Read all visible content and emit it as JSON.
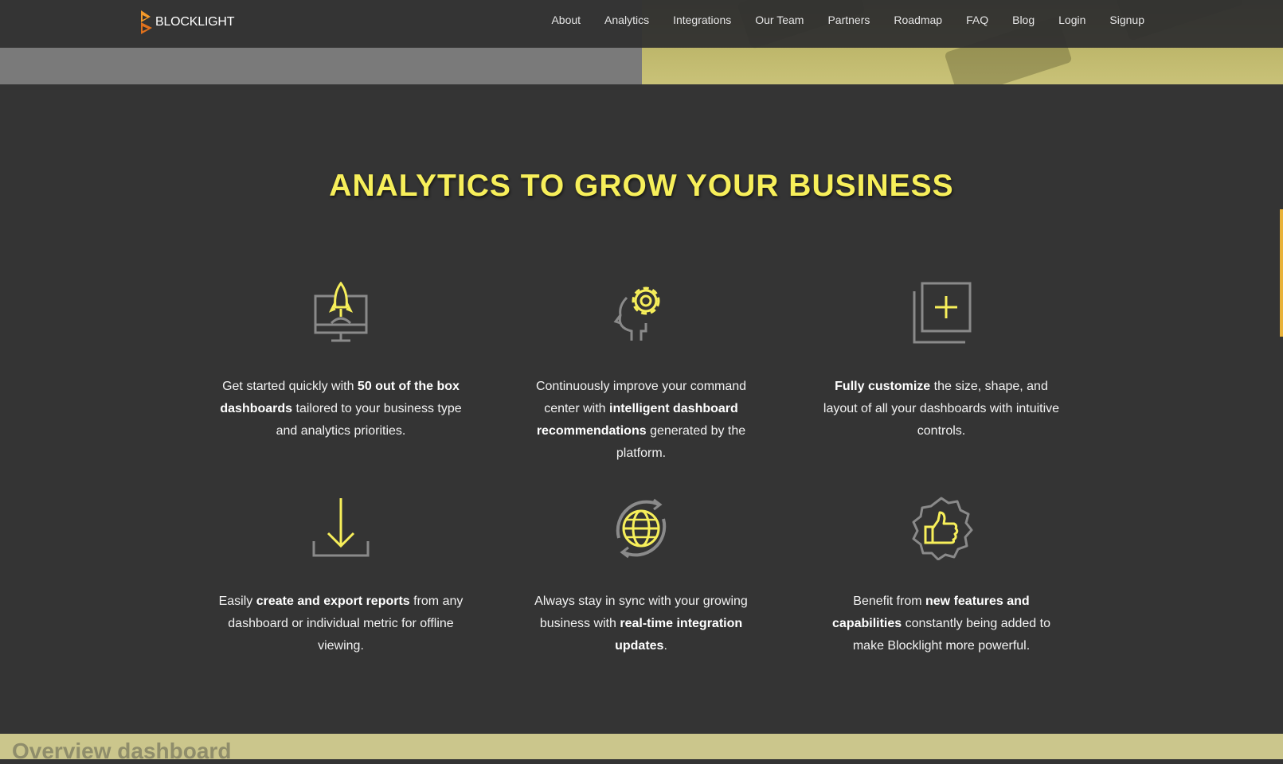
{
  "brand": {
    "name": "BLOCKLIGHT"
  },
  "nav": {
    "links": [
      "About",
      "Analytics",
      "Integrations",
      "Our Team",
      "Partners",
      "Roadmap",
      "FAQ",
      "Blog",
      "Login",
      "Signup"
    ]
  },
  "section": {
    "title": "ANALYTICS TO GROW YOUR BUSINESS"
  },
  "features": [
    {
      "icon": "rocket-monitor-icon",
      "pre": "Get started quickly with ",
      "bold": "50 out of the box dashboards",
      "post": " tailored to your business type and analytics priorities."
    },
    {
      "icon": "head-gear-icon",
      "pre": "Continuously improve your command center with ",
      "bold": "intelligent dashboard recommendations",
      "post": " generated by the platform."
    },
    {
      "icon": "add-layer-icon",
      "pre": "",
      "bold": "Fully customize",
      "post": " the size, shape, and layout of all your dashboards with intuitive controls."
    },
    {
      "icon": "download-icon",
      "pre": "Easily ",
      "bold": "create and export reports",
      "post": " from any dashboard or individual metric for offline viewing."
    },
    {
      "icon": "globe-sync-icon",
      "pre": "Always stay in sync with your growing business with ",
      "bold": "real-time integration updates",
      "post": "."
    },
    {
      "icon": "thumbs-up-badge-icon",
      "pre": "Benefit from ",
      "bold": "new features and capabilities",
      "post": " constantly being added to make Blocklight more powerful."
    }
  ],
  "next_section": {
    "title": "Overview dashboard"
  },
  "colors": {
    "accent": "#f7ef5a",
    "background": "#343434",
    "icon_gray": "#8a8a8a",
    "band": "#cbc68c"
  }
}
